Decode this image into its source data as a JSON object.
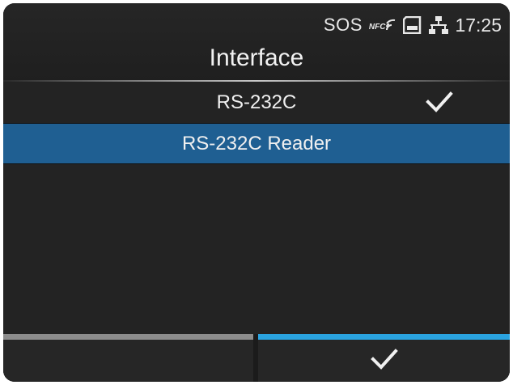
{
  "status_bar": {
    "sos": "SOS",
    "nfc_label": "NFC",
    "time": "17:25",
    "icons": [
      "nfc-icon",
      "sd-card-icon",
      "network-icon"
    ]
  },
  "header": {
    "title": "Interface"
  },
  "options": [
    {
      "label": "RS-232C",
      "checked": true
    },
    {
      "label": "RS-232C Reader",
      "highlighted": true
    }
  ],
  "footer": {
    "left_button": "back",
    "right_button": "confirm-check"
  },
  "colors": {
    "background": "#232323",
    "highlight": "#1f5f92",
    "confirm_accent": "#2aa3e0",
    "back_accent": "#8c8c8c"
  }
}
